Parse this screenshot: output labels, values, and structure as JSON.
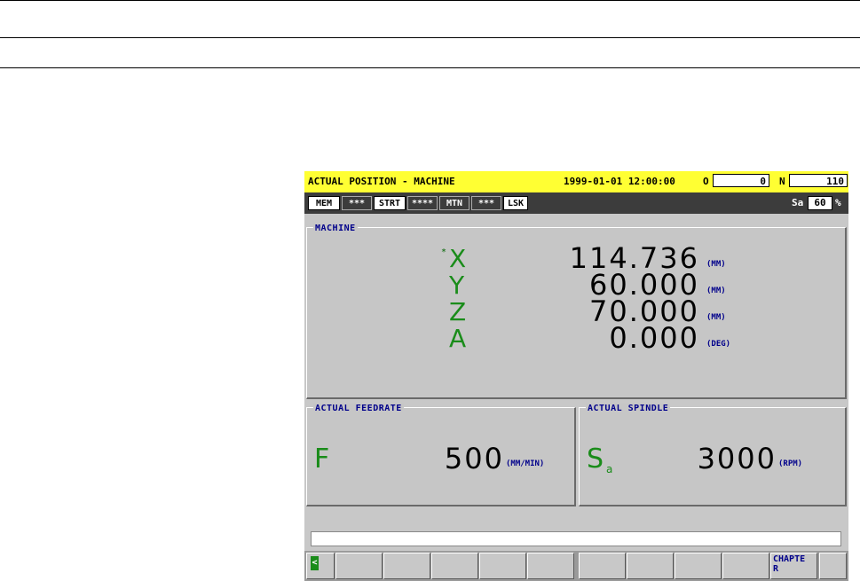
{
  "title_bar": {
    "screen_title": "ACTUAL POSITION - MACHINE",
    "datetime": "1999-01-01 12:00:00",
    "o_label": "O",
    "o_value": "0",
    "n_label": "N",
    "n_value": "110"
  },
  "status_bar": {
    "items": [
      "MEM",
      "***",
      "STRT",
      "****",
      "MTN",
      "***",
      "LSK"
    ],
    "spindle_override_label": "Sa",
    "spindle_override_value": "60",
    "percent_sign": "%"
  },
  "machine_panel": {
    "title": "MACHINE",
    "axes": [
      {
        "marker": "*",
        "name": "X",
        "value": "114.736",
        "unit": "(MM)"
      },
      {
        "marker": "",
        "name": "Y",
        "value": "60.000",
        "unit": "(MM)"
      },
      {
        "marker": "",
        "name": "Z",
        "value": "70.000",
        "unit": "(MM)"
      },
      {
        "marker": "",
        "name": "A",
        "value": "0.000",
        "unit": "(DEG)"
      }
    ]
  },
  "feedrate_panel": {
    "title": "ACTUAL FEEDRATE",
    "letter": "F",
    "value": "500",
    "unit": "(MM/MIN)"
  },
  "spindle_panel": {
    "title": "ACTUAL SPINDLE",
    "letter": "S",
    "subscript": "a",
    "value": "3000",
    "unit": "(RPM)"
  },
  "softkeys": {
    "left_arrow": "<",
    "labels": [
      "",
      "",
      "",
      "",
      "",
      "",
      "",
      "",
      "",
      "",
      "CHAPTE R",
      ""
    ]
  },
  "colors": {
    "title_bar_bg": "#ffff33",
    "status_bar_bg": "#3c3c3c",
    "axis_letter": "#1a8c1a",
    "unit_text": "#00008b"
  }
}
